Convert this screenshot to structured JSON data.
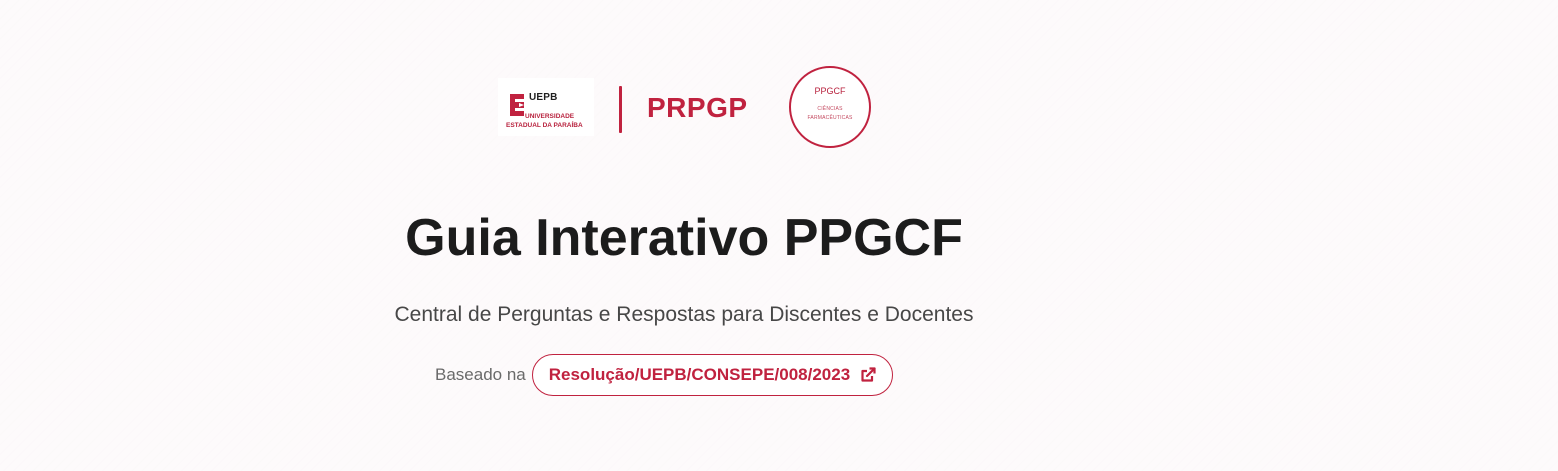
{
  "header": {
    "uepb_logo": {
      "name": "UEPB",
      "line1": "UNIVERSIDADE",
      "line2": "ESTADUAL DA PARAÍBA"
    },
    "prpgp": "PRPGP",
    "ppgcf_badge": {
      "title": "PPGCF",
      "sub1": "CIÊNCIAS",
      "sub2": "FARMACÊUTICAS"
    }
  },
  "main": {
    "title": "Guia Interativo PPGCF",
    "subtitle": "Central de Perguntas e Respostas para Discentes e Docentes",
    "basis_label": "Baseado na",
    "resolution_link": "Resolução/UEPB/CONSEPE/008/2023"
  },
  "colors": {
    "accent": "#c0223f",
    "background": "#fdfafb",
    "title": "#1c1c1c"
  },
  "icons": {
    "external_link": "external-link-icon"
  }
}
